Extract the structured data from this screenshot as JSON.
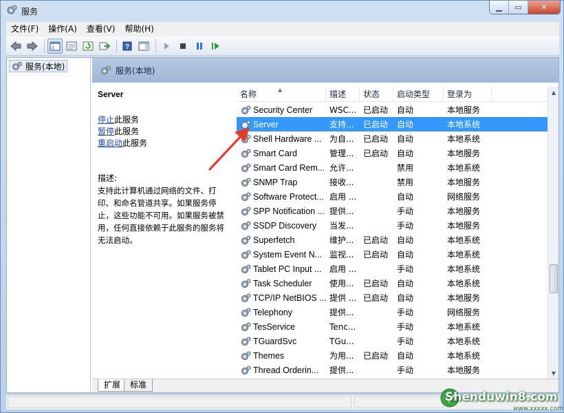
{
  "window": {
    "title": "服务"
  },
  "menu": [
    "文件(F)",
    "操作(A)",
    "查看(V)",
    "帮助(H)"
  ],
  "tree": {
    "root_label": "服务(本地)"
  },
  "detail_header": "服务(本地)",
  "description_pane": {
    "service_name": "Server",
    "actions": [
      {
        "link": "停止",
        "rest": "此服务"
      },
      {
        "link": "暂停",
        "rest": "此服务"
      },
      {
        "link": "重启动",
        "rest": "此服务"
      }
    ],
    "desc_label": "描述:",
    "desc_text": "支持此计算机通过网络的文件、打印、和命名管道共享。如果服务停止，这些功能不可用。如果服务被禁用，任何直接依赖于此服务的服务将无法启动。"
  },
  "columns": {
    "name": "名称",
    "desc": "描述",
    "status": "状态",
    "startup": "启动类型",
    "logon": "登录为"
  },
  "services": [
    {
      "name": "Security Center",
      "desc": "WSC...",
      "status": "已启动",
      "startup": "自动",
      "logon": "本地服务"
    },
    {
      "name": "Server",
      "desc": "支持...",
      "status": "已启动",
      "startup": "自动",
      "logon": "本地系统",
      "selected": true
    },
    {
      "name": "Shell Hardware ...",
      "desc": "为自...",
      "status": "已启动",
      "startup": "自动",
      "logon": "本地系统"
    },
    {
      "name": "Smart Card",
      "desc": "管理...",
      "status": "已启动",
      "startup": "自动",
      "logon": "本地服务"
    },
    {
      "name": "Smart Card Rem...",
      "desc": "允许...",
      "status": "",
      "startup": "禁用",
      "logon": "本地系统"
    },
    {
      "name": "SNMP Trap",
      "desc": "接收...",
      "status": "",
      "startup": "禁用",
      "logon": "本地服务"
    },
    {
      "name": "Software Protect...",
      "desc": "启用 ...",
      "status": "",
      "startup": "自动",
      "logon": "网络服务"
    },
    {
      "name": "SPP Notification ...",
      "desc": "提供...",
      "status": "",
      "startup": "手动",
      "logon": "本地服务"
    },
    {
      "name": "SSDP Discovery",
      "desc": "当发...",
      "status": "",
      "startup": "手动",
      "logon": "本地服务"
    },
    {
      "name": "Superfetch",
      "desc": "维护...",
      "status": "已启动",
      "startup": "自动",
      "logon": "本地系统"
    },
    {
      "name": "System Event N...",
      "desc": "监视...",
      "status": "已启动",
      "startup": "自动",
      "logon": "本地系统"
    },
    {
      "name": "Tablet PC Input ...",
      "desc": "启用 ...",
      "status": "",
      "startup": "手动",
      "logon": "本地系统"
    },
    {
      "name": "Task Scheduler",
      "desc": "使用...",
      "status": "已启动",
      "startup": "自动",
      "logon": "本地系统"
    },
    {
      "name": "TCP/IP NetBIOS ...",
      "desc": "提供 ...",
      "status": "已启动",
      "startup": "自动",
      "logon": "本地服务"
    },
    {
      "name": "Telephony",
      "desc": "提供...",
      "status": "",
      "startup": "手动",
      "logon": "网络服务"
    },
    {
      "name": "TesService",
      "desc": "Tenc...",
      "status": "",
      "startup": "手动",
      "logon": "本地系统"
    },
    {
      "name": "TGuardSvc",
      "desc": "TGu...",
      "status": "",
      "startup": "手动",
      "logon": "本地系统"
    },
    {
      "name": "Themes",
      "desc": "为用...",
      "status": "已启动",
      "startup": "自动",
      "logon": "本地系统"
    },
    {
      "name": "Thread Orderin...",
      "desc": "提供...",
      "status": "",
      "startup": "手动",
      "logon": "本地服务"
    }
  ],
  "tabs": [
    "扩展",
    "标准"
  ],
  "watermark": {
    "text": "Shenduwin8.com",
    "sub": "www.xxxxx.com"
  },
  "colors": {
    "selection": "#3399ff",
    "link": "#1d4bb8",
    "arrow": "#e53b2f"
  }
}
